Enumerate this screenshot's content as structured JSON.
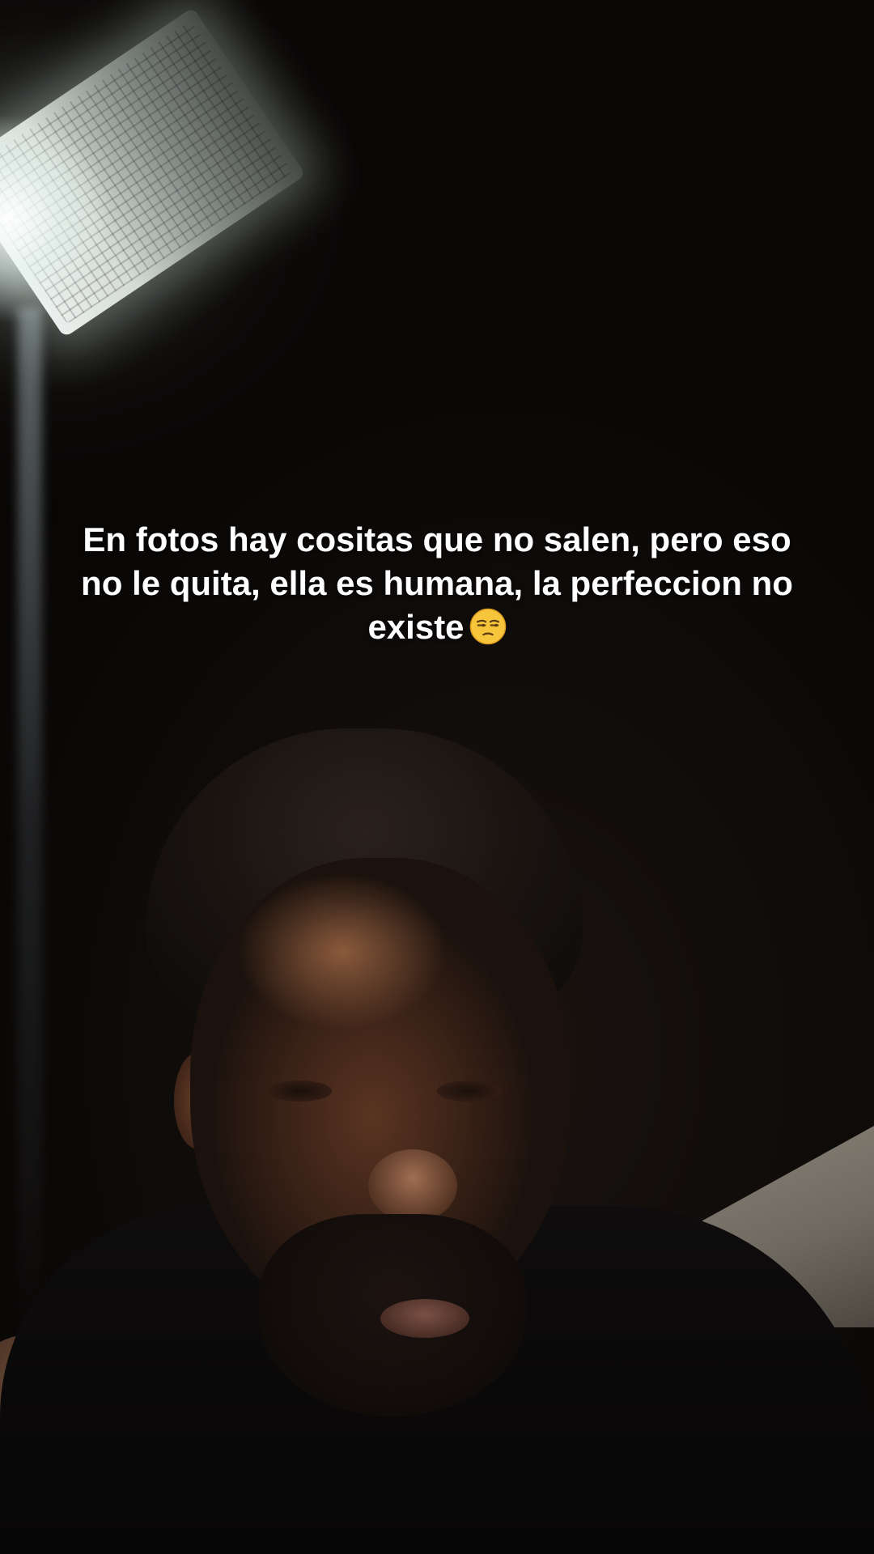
{
  "caption": {
    "text": "En fotos hay cositas que no salen, pero eso no le quita, ella es humana, la perfeccion no existe",
    "emoji_icon": "unamused-face-emoji"
  }
}
